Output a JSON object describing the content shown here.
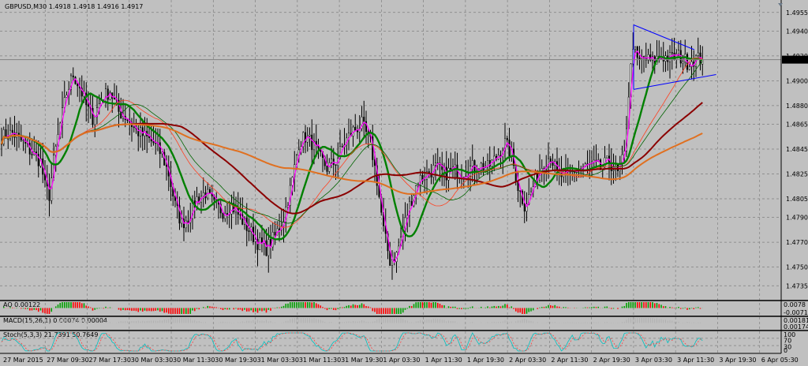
{
  "chart_data": {
    "type": "candlestick",
    "symbol_header": "GBPUSD,M30  1.4918 1.4918 1.4916 1.4917",
    "current_price": 1.4917,
    "current_price_label": "1.4917",
    "ylim": [
      1.4725,
      1.4965
    ],
    "y_ticks": [
      "1.4955",
      "1.4940",
      "1.4920",
      "1.4900",
      "1.4880",
      "1.4865",
      "1.4845",
      "1.4825",
      "1.4805",
      "1.4790",
      "1.4770",
      "1.4750",
      "1.4735"
    ],
    "x_ticks": [
      "27 Mar 2015",
      "27 Mar 09:30",
      "27 Mar 17:30",
      "30 Mar 03:30",
      "30 Mar 11:30",
      "30 Mar 19:30",
      "31 Mar 03:30",
      "31 Mar 11:30",
      "31 Mar 19:30",
      "1 Apr 03:30",
      "1 Apr 11:30",
      "1 Apr 19:30",
      "2 Apr 03:30",
      "2 Apr 11:30",
      "2 Apr 19:30",
      "3 Apr 03:30",
      "3 Apr 11:30",
      "3 Apr 19:30",
      "6 Apr 05:30"
    ],
    "close_path": [
      [
        0,
        1.4855
      ],
      [
        5,
        1.4858
      ],
      [
        10,
        1.485
      ],
      [
        14,
        1.4842
      ],
      [
        18,
        1.4835
      ],
      [
        20,
        1.4815
      ],
      [
        22,
        1.4808
      ],
      [
        24,
        1.4835
      ],
      [
        27,
        1.4865
      ],
      [
        30,
        1.489
      ],
      [
        33,
        1.4905
      ],
      [
        36,
        1.4895
      ],
      [
        39,
        1.488
      ],
      [
        42,
        1.487
      ],
      [
        46,
        1.4885
      ],
      [
        50,
        1.4892
      ],
      [
        54,
        1.4875
      ],
      [
        58,
        1.487
      ],
      [
        62,
        1.486
      ],
      [
        66,
        1.4855
      ],
      [
        70,
        1.485
      ],
      [
        74,
        1.484
      ],
      [
        77,
        1.4825
      ],
      [
        80,
        1.48
      ],
      [
        83,
        1.4785
      ],
      [
        86,
        1.479
      ],
      [
        90,
        1.4805
      ],
      [
        94,
        1.481
      ],
      [
        98,
        1.48
      ],
      [
        102,
        1.4795
      ],
      [
        106,
        1.48
      ],
      [
        110,
        1.479
      ],
      [
        114,
        1.478
      ],
      [
        118,
        1.477
      ],
      [
        122,
        1.4765
      ],
      [
        126,
        1.4775
      ],
      [
        130,
        1.479
      ],
      [
        134,
        1.482
      ],
      [
        137,
        1.485
      ],
      [
        140,
        1.4855
      ],
      [
        143,
        1.485
      ],
      [
        146,
        1.484
      ],
      [
        150,
        1.483
      ],
      [
        154,
        1.4835
      ],
      [
        158,
        1.485
      ],
      [
        162,
        1.486
      ],
      [
        166,
        1.4865
      ],
      [
        170,
        1.485
      ],
      [
        173,
        1.482
      ],
      [
        176,
        1.478
      ],
      [
        179,
        1.4755
      ],
      [
        182,
        1.476
      ],
      [
        185,
        1.478
      ],
      [
        188,
        1.48
      ],
      [
        192,
        1.482
      ],
      [
        196,
        1.4825
      ],
      [
        200,
        1.483
      ],
      [
        204,
        1.4825
      ],
      [
        208,
        1.4828
      ],
      [
        212,
        1.4826
      ],
      [
        216,
        1.483
      ],
      [
        220,
        1.4832
      ],
      [
        224,
        1.483
      ],
      [
        228,
        1.4838
      ],
      [
        232,
        1.485
      ],
      [
        235,
        1.484
      ],
      [
        238,
        1.4815
      ],
      [
        241,
        1.48
      ],
      [
        244,
        1.481
      ],
      [
        247,
        1.4825
      ],
      [
        250,
        1.4835
      ],
      [
        253,
        1.484
      ],
      [
        256,
        1.4825
      ],
      [
        260,
        1.4822
      ],
      [
        264,
        1.4828
      ],
      [
        268,
        1.483
      ],
      [
        272,
        1.4832
      ],
      [
        276,
        1.483
      ],
      [
        280,
        1.4835
      ],
      [
        284,
        1.4825
      ],
      [
        287,
        1.484
      ],
      [
        289,
        1.489
      ],
      [
        291,
        1.493
      ],
      [
        293,
        1.4915
      ],
      [
        296,
        1.4918
      ],
      [
        300,
        1.4915
      ],
      [
        304,
        1.492
      ],
      [
        308,
        1.4918
      ],
      [
        312,
        1.492
      ],
      [
        316,
        1.4915
      ],
      [
        320,
        1.4918
      ],
      [
        323,
        1.4917
      ]
    ],
    "overlays": [
      {
        "color": "#ff00ff",
        "style": "fast-ma"
      },
      {
        "color": "#008000",
        "style": "ma"
      },
      {
        "color": "#ff4020",
        "style": "ma-thin"
      },
      {
        "color": "#006400",
        "style": "ma-thin"
      },
      {
        "color": "#8b0000",
        "style": "ma"
      },
      {
        "color": "#e07020",
        "style": "ma"
      }
    ],
    "triangle_color": "#0000ff",
    "triangle_top": [
      [
        292,
        1.4945
      ],
      [
        320,
        1.4925
      ]
    ],
    "triangle_bottom": [
      [
        292,
        1.4893
      ],
      [
        330,
        1.4905
      ]
    ],
    "indicators": [
      {
        "label": "AO 0.00122",
        "axis": [
          "0.0078",
          "-0.00712"
        ],
        "colors": [
          "#00a000",
          "#ff0000"
        ]
      },
      {
        "label": "MACD(15,26,1) 0.00074 0.00004",
        "axis": [
          "0.00181",
          "0.00174"
        ],
        "color": "#b0b0b0"
      },
      {
        "label": "Stoch(5,3,3) 21.7391 50.7649",
        "axis": [
          "100",
          "70",
          "30",
          "0"
        ],
        "colors": [
          "#00c0c0",
          "#ff4040"
        ]
      }
    ]
  }
}
